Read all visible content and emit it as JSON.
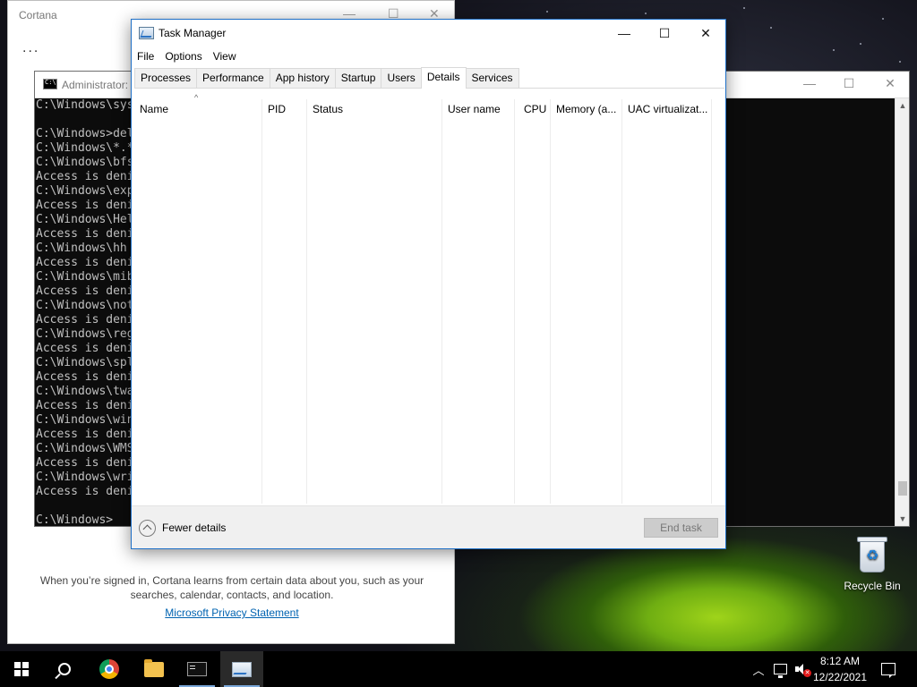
{
  "desktop": {
    "recycle_bin_label": "Recycle Bin"
  },
  "cortana": {
    "title": "Cortana",
    "more_label": "...",
    "privacy_text": "When you’re signed in, Cortana learns from certain data about you, such as your searches, calendar, contacts, and location.",
    "privacy_link": "Microsoft Privacy Statement"
  },
  "cmd": {
    "title": "Administrator:",
    "lines": [
      "C:\\Windows\\sys",
      "",
      "C:\\Windows>del",
      "C:\\Windows\\*.*",
      "C:\\Windows\\bfs",
      "Access is deni",
      "C:\\Windows\\exp",
      "Access is deni",
      "C:\\Windows\\Hel",
      "Access is deni",
      "C:\\Windows\\hh",
      "Access is deni",
      "C:\\Windows\\mib",
      "Access is deni",
      "C:\\Windows\\not",
      "Access is deni",
      "C:\\Windows\\reg",
      "Access is deni",
      "C:\\Windows\\spl",
      "Access is deni",
      "C:\\Windows\\twa",
      "Access is deni",
      "C:\\Windows\\win",
      "Access is deni",
      "C:\\Windows\\WMS",
      "Access is deni",
      "C:\\Windows\\wri",
      "Access is deni",
      "",
      "C:\\Windows>"
    ]
  },
  "task_manager": {
    "title": "Task Manager",
    "menu": [
      "File",
      "Options",
      "View"
    ],
    "tabs": [
      "Processes",
      "Performance",
      "App history",
      "Startup",
      "Users",
      "Details",
      "Services"
    ],
    "active_tab": "Details",
    "columns": [
      "Name",
      "PID",
      "Status",
      "User name",
      "CPU",
      "Memory (a...",
      "UAC virtualizat..."
    ],
    "fewer_details": "Fewer details",
    "end_task": "End task"
  },
  "taskbar": {
    "time": "8:12 AM",
    "date": "12/22/2021"
  }
}
